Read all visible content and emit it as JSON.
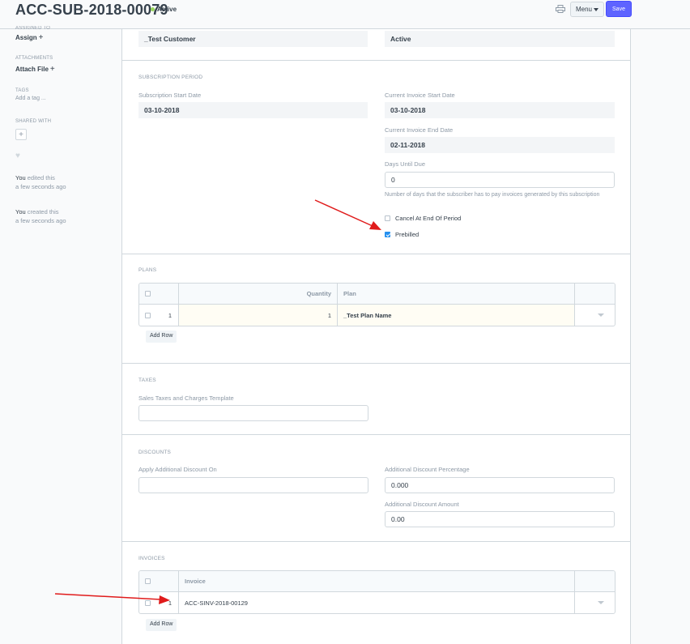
{
  "header": {
    "title": "ACC-SUB-2018-00079",
    "status": "Active",
    "menu_label": "Menu",
    "save_label": "Save"
  },
  "sidebar": {
    "assigned_to_label": "ASSIGNED TO",
    "assign_link": "Assign",
    "attachments_label": "ATTACHMENTS",
    "attach_link": "Attach File",
    "tags_label": "TAGS",
    "tags_placeholder": "Add a tag ...",
    "shared_with_label": "SHARED WITH",
    "activity": [
      {
        "user": "You",
        "action": " edited this",
        "time": "a few seconds ago"
      },
      {
        "user": "You",
        "action": " created this",
        "time": "a few seconds ago"
      }
    ]
  },
  "top_fields": {
    "customer": "_Test Customer",
    "status": "Active"
  },
  "subscription_period": {
    "heading": "SUBSCRIPTION PERIOD",
    "start_date_label": "Subscription Start Date",
    "start_date": "03-10-2018",
    "inv_start_label": "Current Invoice Start Date",
    "inv_start": "03-10-2018",
    "inv_end_label": "Current Invoice End Date",
    "inv_end": "02-11-2018",
    "days_due_label": "Days Until Due",
    "days_due": "0",
    "days_due_help": "Number of days that the subscriber has to pay invoices generated by this subscription",
    "cancel_label": "Cancel At End Of Period",
    "cancel_checked": false,
    "prebilled_label": "Prebilled",
    "prebilled_checked": true
  },
  "plans": {
    "heading": "PLANS",
    "columns": [
      "Quantity",
      "Plan"
    ],
    "rows": [
      {
        "idx": "1",
        "quantity": "1",
        "plan": "_Test Plan Name"
      }
    ],
    "add_row": "Add Row"
  },
  "taxes": {
    "heading": "TAXES",
    "template_label": "Sales Taxes and Charges Template",
    "template_value": ""
  },
  "discounts": {
    "heading": "DISCOUNTS",
    "apply_on_label": "Apply Additional Discount On",
    "apply_on_value": "",
    "pct_label": "Additional Discount Percentage",
    "pct_value": "0.000",
    "amount_label": "Additional Discount Amount",
    "amount_value": "0.00"
  },
  "invoices": {
    "heading": "INVOICES",
    "columns": [
      "Invoice"
    ],
    "rows": [
      {
        "idx": "1",
        "invoice": "ACC-SINV-2018-00129"
      }
    ],
    "add_row": "Add Row"
  },
  "colors": {
    "primary": "#5e64ff",
    "indicator_green": "#98d85b",
    "annotation_arrow": "#e01b1b"
  }
}
